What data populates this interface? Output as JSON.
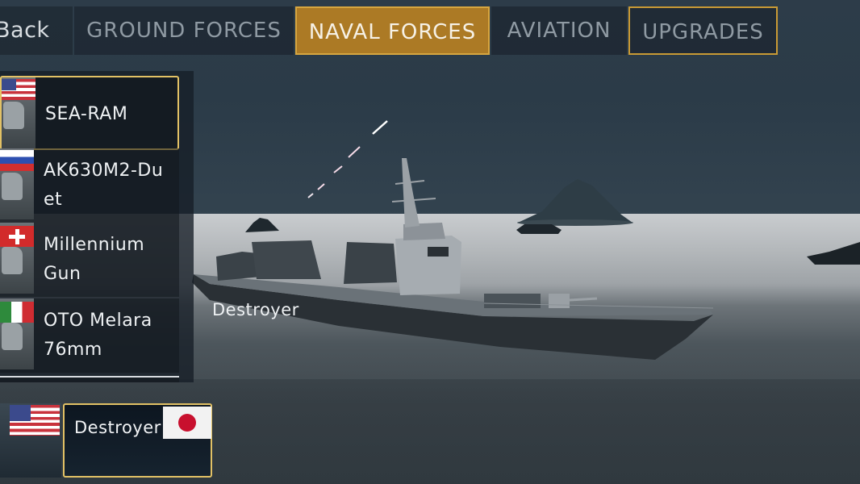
{
  "nav": {
    "back_label": "Back",
    "tabs": [
      {
        "label": "GROUND FORCES",
        "active": false
      },
      {
        "label": "NAVAL FORCES",
        "active": true
      },
      {
        "label": "AVIATION",
        "active": false
      },
      {
        "label": "UPGRADES",
        "active": false
      }
    ]
  },
  "weapons": [
    {
      "name": "SEA-RAM",
      "flag": "us-flag-icon",
      "selected": true
    },
    {
      "name": "AK630M2-Du et",
      "flag": "russia-flag-icon",
      "selected": false
    },
    {
      "name": "Millennium Gun",
      "flag": "switzerland-flag-icon",
      "selected": false
    },
    {
      "name": "OTO Melara 76mm",
      "flag": "italy-flag-icon",
      "selected": false
    }
  ],
  "ship_label": "Destroyer",
  "ships": [
    {
      "name": "",
      "flag": "us-flag-icon",
      "selected": false
    },
    {
      "name": "Destroyer",
      "flag": "japan-flag-icon",
      "selected": true
    }
  ],
  "colors": {
    "active_tab": "#ac7a25",
    "selection_border": "#e2c165",
    "panel_bg": "#1e2832"
  }
}
